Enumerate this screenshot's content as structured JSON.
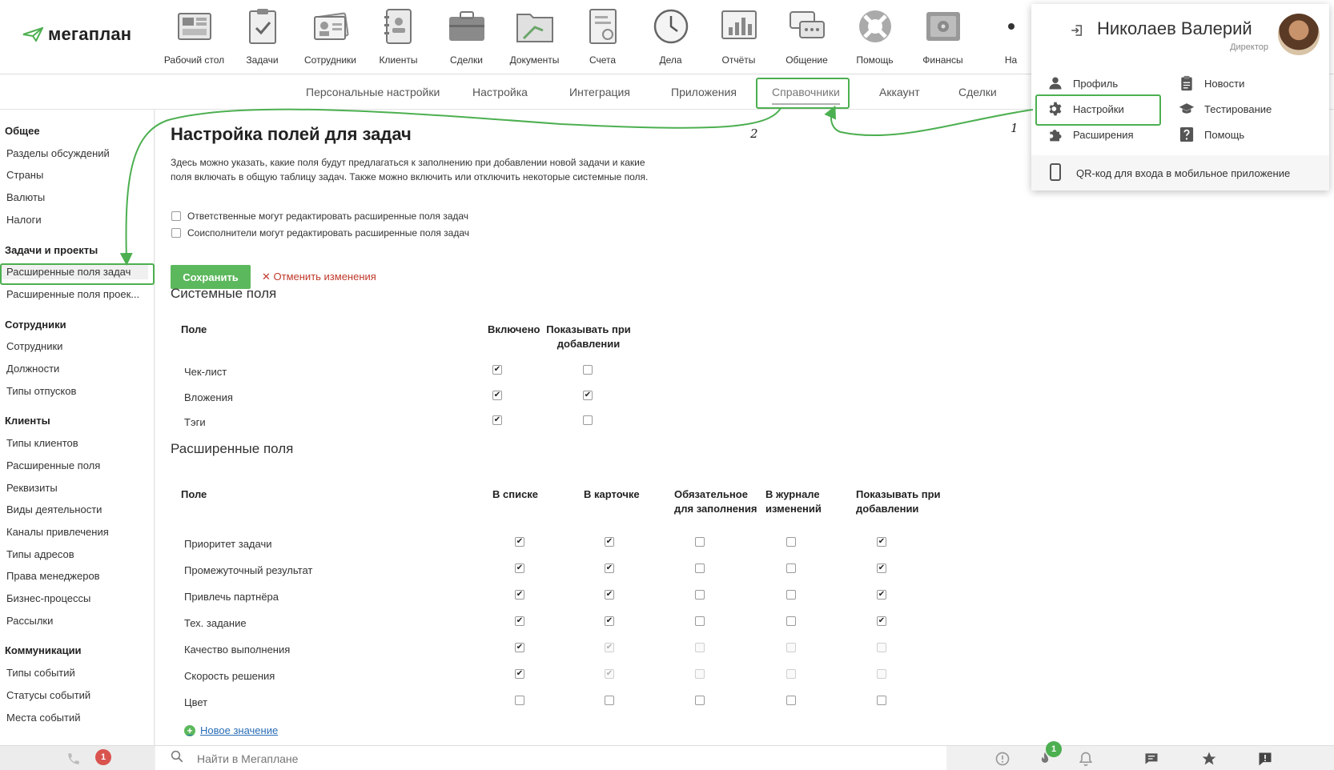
{
  "logo": {
    "text": "мегаплан"
  },
  "modules": [
    {
      "label": "Рабочий стол",
      "icon": "desktop-icon"
    },
    {
      "label": "Задачи",
      "icon": "tasks-icon"
    },
    {
      "label": "Сотрудники",
      "icon": "employees-icon"
    },
    {
      "label": "Клиенты",
      "icon": "clients-icon"
    },
    {
      "label": "Сделки",
      "icon": "deals-icon"
    },
    {
      "label": "Документы",
      "icon": "documents-icon"
    },
    {
      "label": "Счета",
      "icon": "invoices-icon"
    },
    {
      "label": "Дела",
      "icon": "clock-icon"
    },
    {
      "label": "Отчёты",
      "icon": "reports-icon"
    },
    {
      "label": "Общение",
      "icon": "chat-icon"
    },
    {
      "label": "Помощь",
      "icon": "lifebuoy-icon"
    },
    {
      "label": "Финансы",
      "icon": "safe-icon"
    },
    {
      "label": "На",
      "icon": "more-icon"
    }
  ],
  "subnav": [
    {
      "label": "Персональные настройки"
    },
    {
      "label": "Настройка"
    },
    {
      "label": "Интеграция"
    },
    {
      "label": "Приложения"
    },
    {
      "label": "Справочники",
      "active": true
    },
    {
      "label": "Аккаунт"
    },
    {
      "label": "Сделки"
    }
  ],
  "sidebar": [
    {
      "type": "group",
      "label": "Общее"
    },
    {
      "type": "item",
      "label": "Разделы обсуждений"
    },
    {
      "type": "item",
      "label": "Страны"
    },
    {
      "type": "item",
      "label": "Валюты"
    },
    {
      "type": "item",
      "label": "Налоги"
    },
    {
      "type": "group",
      "label": "Задачи и проекты"
    },
    {
      "type": "item",
      "label": "Расширенные поля задач",
      "active": true
    },
    {
      "type": "item",
      "label": "Расширенные поля проек..."
    },
    {
      "type": "group",
      "label": "Сотрудники"
    },
    {
      "type": "item",
      "label": "Сотрудники"
    },
    {
      "type": "item",
      "label": "Должности"
    },
    {
      "type": "item",
      "label": "Типы отпусков"
    },
    {
      "type": "group",
      "label": "Клиенты"
    },
    {
      "type": "item",
      "label": "Типы клиентов"
    },
    {
      "type": "item",
      "label": "Расширенные поля"
    },
    {
      "type": "item",
      "label": "Реквизиты"
    },
    {
      "type": "item",
      "label": "Виды деятельности"
    },
    {
      "type": "item",
      "label": "Каналы привлечения"
    },
    {
      "type": "item",
      "label": "Типы адресов"
    },
    {
      "type": "item",
      "label": "Права менеджеров"
    },
    {
      "type": "item",
      "label": "Бизнес-процессы"
    },
    {
      "type": "item",
      "label": "Рассылки"
    },
    {
      "type": "group",
      "label": "Коммуникации"
    },
    {
      "type": "item",
      "label": "Типы событий"
    },
    {
      "type": "item",
      "label": "Статусы событий"
    },
    {
      "type": "item",
      "label": "Места событий"
    }
  ],
  "main": {
    "title": "Настройка полей для задач",
    "description": "Здесь можно указать, какие поля будут предлагаться к заполнению при добавлении новой задачи и какие поля включать в общую таблицу задач. Также можно включить или отключить некоторые системные поля.",
    "options": [
      {
        "label": "Ответственные могут редактировать расширенные поля задач",
        "checked": false
      },
      {
        "label": "Соисполнители могут редактировать расширенные поля задач",
        "checked": false
      }
    ],
    "save_label": "Сохранить",
    "cancel_label": "Отменить изменения",
    "system_section": {
      "title": "Системные поля",
      "headers": [
        "Поле",
        "Включено",
        "Показывать при добавлении"
      ],
      "rows": [
        {
          "label": "Чек-лист",
          "values": [
            true,
            false
          ]
        },
        {
          "label": "Вложения",
          "values": [
            true,
            true
          ]
        },
        {
          "label": "Тэги",
          "values": [
            true,
            false
          ]
        }
      ]
    },
    "extended_section": {
      "title": "Расширенные поля",
      "headers": [
        "Поле",
        "В списке",
        "В карточке",
        "Обязательное для заполнения",
        "В журнале изменений",
        "Показывать при добавлении"
      ],
      "rows": [
        {
          "label": "Приоритет задачи",
          "values": [
            "on",
            "on",
            "off",
            "off",
            "on"
          ]
        },
        {
          "label": "Промежуточный результат",
          "values": [
            "on",
            "on",
            "off",
            "off",
            "on"
          ]
        },
        {
          "label": "Привлечь партнёра",
          "values": [
            "on",
            "on",
            "off",
            "off",
            "on"
          ]
        },
        {
          "label": "Тех. задание",
          "values": [
            "on",
            "on",
            "off",
            "off",
            "on"
          ]
        },
        {
          "label": "Качество выполнения",
          "values": [
            "on",
            "dis-on",
            "dis",
            "dis",
            "dis"
          ]
        },
        {
          "label": "Скорость решения",
          "values": [
            "on",
            "dis-on",
            "dis",
            "dis",
            "dis"
          ]
        },
        {
          "label": "Цвет",
          "values": [
            "off",
            "off",
            "off",
            "off",
            "off"
          ]
        }
      ]
    },
    "new_value_label": "Новое значение"
  },
  "bottombar": {
    "calls_badge": "1",
    "search_placeholder": "Найти в Мегаплане",
    "fire_badge": "1"
  },
  "popup": {
    "user_name": "Николаев Валерий",
    "user_role": "Директор",
    "menu_left": [
      {
        "label": "Профиль",
        "icon": "user-icon"
      },
      {
        "label": "Настройки",
        "icon": "gear-icon"
      },
      {
        "label": "Расширения",
        "icon": "puzzle-icon"
      }
    ],
    "menu_right": [
      {
        "label": "Новости",
        "icon": "clipboard-icon"
      },
      {
        "label": "Тестирование",
        "icon": "graduation-cap-icon"
      },
      {
        "label": "Помощь",
        "icon": "question-icon"
      }
    ],
    "qr_label": "QR-код для входа в мобильное приложение"
  },
  "annotations": [
    "1",
    "2"
  ],
  "colors": {
    "accent_green": "#5cb85c",
    "highlight": "#4caf50",
    "cancel_red": "#c0392b",
    "badge_red": "#d9534f"
  }
}
